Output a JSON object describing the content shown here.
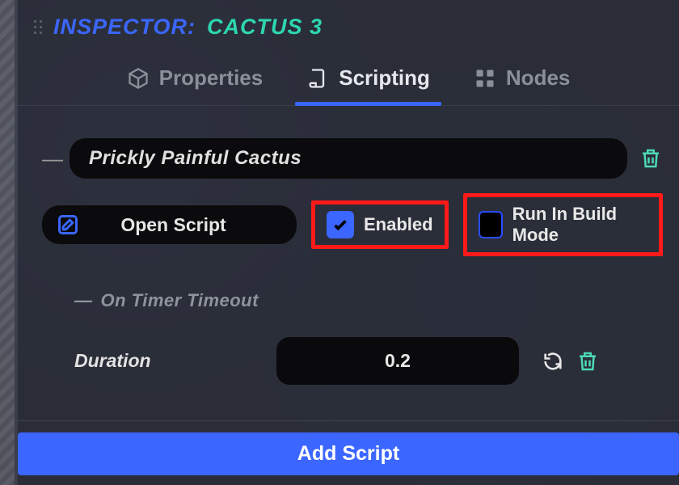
{
  "header": {
    "title": "INSPECTOR:",
    "object": "CACTUS 3"
  },
  "tabs": {
    "properties": "Properties",
    "scripting": "Scripting",
    "nodes": "Nodes",
    "active": "scripting"
  },
  "script": {
    "name": "Prickly Painful Cactus",
    "open_label": "Open Script",
    "enabled_label": "Enabled",
    "enabled_checked": true,
    "run_build_label": "Run In Build Mode",
    "run_build_checked": false
  },
  "section": {
    "title": "On Timer Timeout",
    "props": {
      "duration_label": "Duration",
      "duration_value": "0.2"
    }
  },
  "footer": {
    "add_script": "Add Script"
  }
}
